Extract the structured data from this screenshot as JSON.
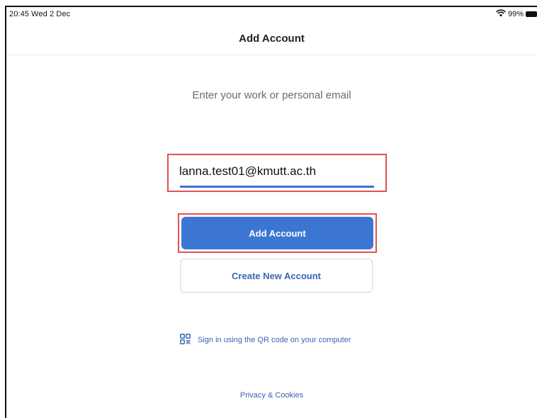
{
  "status_bar": {
    "time": "20:45  Wed 2 Dec",
    "battery": "99%",
    "wifi_icon": "wifi-icon",
    "battery_icon": "battery-icon"
  },
  "nav": {
    "title": "Add Account"
  },
  "prompt": "Enter your work or personal email",
  "email_field": {
    "value": "lanna.test01@kmutt.ac.th",
    "highlight_color": "#e05252"
  },
  "buttons": {
    "add_account": "Add Account",
    "create_account": "Create New Account"
  },
  "qr_link": {
    "label": "Sign in using the QR code on your computer",
    "icon": "qr-code-icon"
  },
  "privacy": "Privacy & Cookies",
  "colors": {
    "accent": "#3c76d3",
    "link": "#3a66b5"
  }
}
